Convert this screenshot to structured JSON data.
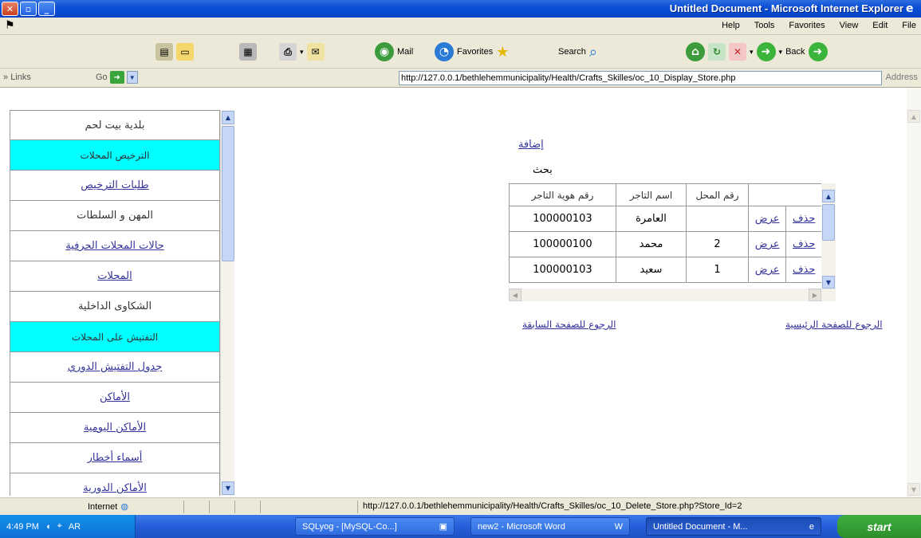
{
  "window": {
    "title": "Untitled Document - Microsoft Internet Explorer",
    "controls": [
      "✕",
      "▫",
      "_"
    ]
  },
  "menu": [
    "File",
    "Edit",
    "View",
    "Favorites",
    "Tools",
    "Help"
  ],
  "toolbar": {
    "back": "Back",
    "search": "Search",
    "favorites": "Favorites",
    "mail": "Mail"
  },
  "address": {
    "links_label": "Links",
    "go_label": "Go",
    "url": "http://127.0.0.1/bethlehemmunicipality/Health/Crafts_Skilles/oc_10_Display_Store.php",
    "label": "Address"
  },
  "nav": {
    "items": [
      {
        "label": "بلدية بيت لحم",
        "kind": "plain"
      },
      {
        "label": "الترخيص المحلات",
        "kind": "hdr"
      },
      {
        "label": "طلبات الترخيص",
        "kind": "link"
      },
      {
        "label": "المهن و السلطات",
        "kind": "plain"
      },
      {
        "label": "حالات المحلات الحرفية",
        "kind": "link"
      },
      {
        "label": "المحلات",
        "kind": "link"
      },
      {
        "label": "الشكاوى الداخلية",
        "kind": "plain"
      },
      {
        "label": "التفتيش على المحلات",
        "kind": "hdr"
      },
      {
        "label": "جدول التفتيش الدوري",
        "kind": "link"
      },
      {
        "label": "الأماكن",
        "kind": "link"
      },
      {
        "label": "الأماكن اليومية",
        "kind": "link"
      },
      {
        "label": "أسماء أخطار",
        "kind": "link"
      },
      {
        "label": "الأماكن الدورية",
        "kind": "link"
      }
    ]
  },
  "main": {
    "add_link": "إضافة",
    "search_label": "بحث",
    "table": {
      "headers": [
        "",
        "رقم المحل",
        "اسم التاجر",
        "رقم هوية التاجر"
      ],
      "rows": [
        {
          "edit": "عرض",
          "del": "حذف",
          "no": "",
          "name": "العامرة",
          "id": "100000103"
        },
        {
          "edit": "عرض",
          "del": "حذف",
          "no": "2",
          "name": "محمد",
          "id": "100000100"
        },
        {
          "edit": "عرض",
          "del": "حذف",
          "no": "1",
          "name": "سعيد",
          "id": "100000103"
        }
      ]
    },
    "link_left": "الرجوع للصفحة السابقة",
    "link_right": "الرجوع للصفحة الرئيسية"
  },
  "status": {
    "zone": "Internet",
    "url": "http://127.0.0.1/bethlehemmunicipality/Health/Crafts_Skilles/oc_10_Delete_Store.php?Store_Id=2"
  },
  "taskbar": {
    "clock": "4:49 PM",
    "lang": "AR",
    "tasks": [
      "SQLyog - [MySQL-Co...]",
      "new2 - Microsoft Word",
      "Untitled Document - M..."
    ],
    "start": "start"
  }
}
